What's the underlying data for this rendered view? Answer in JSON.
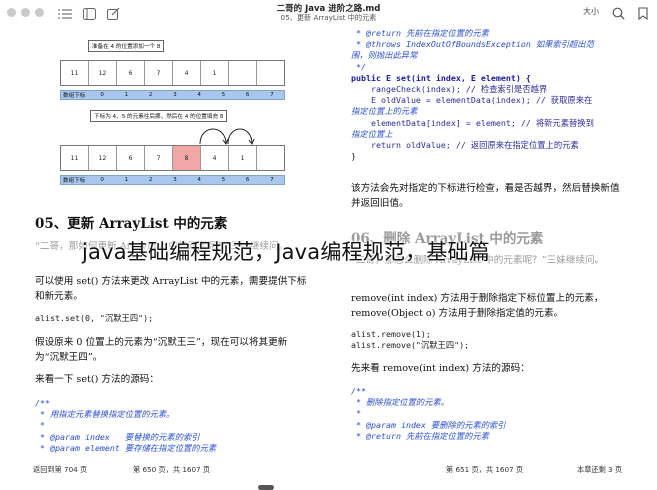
{
  "window": {
    "title": "二哥的 Java 进阶之路.md",
    "subtitle": "05、更新 ArrayList 中的元素",
    "font_button": "大小"
  },
  "figure1": {
    "caption": "准备在 4 的位置添加一个 8",
    "cells": [
      "11",
      "12",
      "6",
      "7",
      "4",
      "1",
      "",
      ""
    ],
    "index_label": "数组下标",
    "indices": [
      "0",
      "1",
      "2",
      "3",
      "4",
      "5",
      "6",
      "7"
    ]
  },
  "figure2": {
    "caption": "下标为 4、5 的元素往后挪，然后在 4 的位置填充 8",
    "cells": [
      "11",
      "12",
      "6",
      "7",
      "8",
      "4",
      "1",
      ""
    ],
    "index_label": "数组下标",
    "indices": [
      "0",
      "1",
      "2",
      "3",
      "4",
      "5",
      "6",
      "7"
    ]
  },
  "left": {
    "heading": "05、更新 ArrayList 中的元素",
    "quote": "“二哥，那如何更新 ArrayList 中的元素呢？”三妹继续问。",
    "para1": "可以使用 set() 方法来更改 ArrayList 中的元素，需要提供下标和新元素。",
    "code1": "alist.set(0, \"沉默王四\");",
    "para2": "假设原来 0 位置上的元素为“沉默王三”，现在可以将其更新为“沉默王四”。",
    "para3": "来看一下 set() 方法的源码：",
    "code2": [
      "/**",
      " * 用指定元素替换指定位置的元素。",
      " *",
      " * @param index   要替换的元素的索引",
      " * @param element 要存储在指定位置的元素"
    ]
  },
  "right": {
    "code_lines": [
      " * @return 先前在指定位置的元素",
      " * @throws IndexOutOfBoundsException 如果索引超出范",
      "围，则抛出此异常",
      " */",
      "public E set(int index, E element) {",
      "    rangeCheck(index); // 检查索引是否越界",
      "",
      "    E oldValue = elementData(index); // 获取原来在",
      "指定位置上的元素",
      "    elementData[index] = element; // 将新元素替换到",
      "指定位置上",
      "    return oldValue; // 返回原来在指定位置上的元素",
      "}"
    ],
    "para1": "该方法会先对指定的下标进行检查，看是否越界，然后替换新值并返回旧值。",
    "heading": "06、删除 ArrayList 中的元素",
    "quote": "“二哥，那怎么删除 ArrayList 中的元素呢？”三妹继续问。",
    "para2": "remove(int index) 方法用于删除指定下标位置上的元素，remove(Object o) 方法用于删除指定值的元素。",
    "code1": [
      "alist.remove(1);",
      "alist.remove(\"沉默王四\");"
    ],
    "para3": "先来看 remove(int index) 方法的源码：",
    "code2": [
      "/**",
      " * 删除指定位置的元素。",
      " *",
      " * @param index 要删除的元素的索引",
      " * @return 先前在指定位置的元素"
    ]
  },
  "footer": {
    "back": "返回到第 704 页",
    "left_page": "第 650 页，共 1607 页",
    "right_page": "第 651 页，共 1607 页",
    "remaining": "本章还剩 3 页"
  },
  "overlay_title": "java基础编程规范，Java编程规范，基础篇"
}
